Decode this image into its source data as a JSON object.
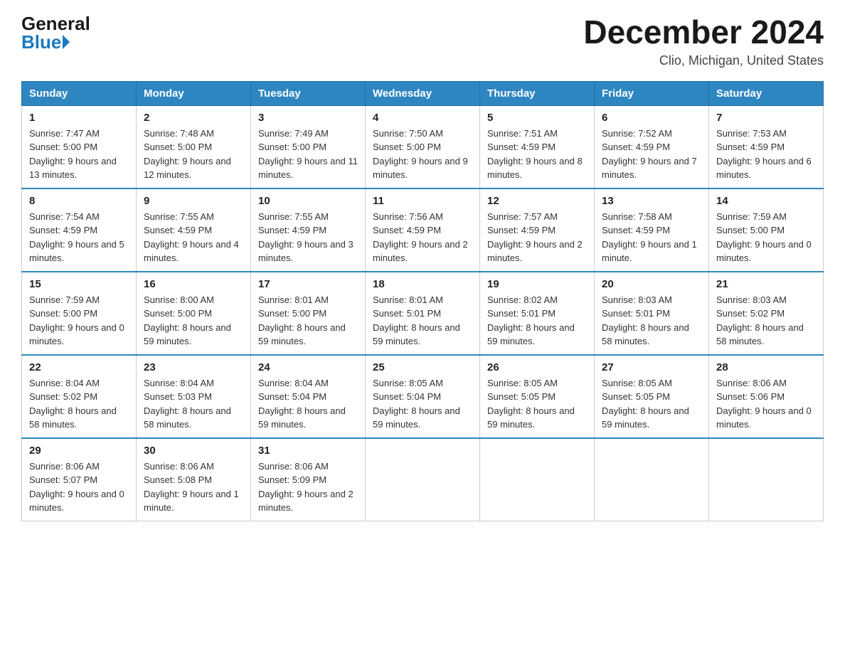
{
  "logo": {
    "general": "General",
    "blue": "Blue"
  },
  "title": "December 2024",
  "subtitle": "Clio, Michigan, United States",
  "days_header": [
    "Sunday",
    "Monday",
    "Tuesday",
    "Wednesday",
    "Thursday",
    "Friday",
    "Saturday"
  ],
  "weeks": [
    [
      {
        "day": "1",
        "sunrise": "7:47 AM",
        "sunset": "5:00 PM",
        "daylight": "9 hours and 13 minutes."
      },
      {
        "day": "2",
        "sunrise": "7:48 AM",
        "sunset": "5:00 PM",
        "daylight": "9 hours and 12 minutes."
      },
      {
        "day": "3",
        "sunrise": "7:49 AM",
        "sunset": "5:00 PM",
        "daylight": "9 hours and 11 minutes."
      },
      {
        "day": "4",
        "sunrise": "7:50 AM",
        "sunset": "5:00 PM",
        "daylight": "9 hours and 9 minutes."
      },
      {
        "day": "5",
        "sunrise": "7:51 AM",
        "sunset": "4:59 PM",
        "daylight": "9 hours and 8 minutes."
      },
      {
        "day": "6",
        "sunrise": "7:52 AM",
        "sunset": "4:59 PM",
        "daylight": "9 hours and 7 minutes."
      },
      {
        "day": "7",
        "sunrise": "7:53 AM",
        "sunset": "4:59 PM",
        "daylight": "9 hours and 6 minutes."
      }
    ],
    [
      {
        "day": "8",
        "sunrise": "7:54 AM",
        "sunset": "4:59 PM",
        "daylight": "9 hours and 5 minutes."
      },
      {
        "day": "9",
        "sunrise": "7:55 AM",
        "sunset": "4:59 PM",
        "daylight": "9 hours and 4 minutes."
      },
      {
        "day": "10",
        "sunrise": "7:55 AM",
        "sunset": "4:59 PM",
        "daylight": "9 hours and 3 minutes."
      },
      {
        "day": "11",
        "sunrise": "7:56 AM",
        "sunset": "4:59 PM",
        "daylight": "9 hours and 2 minutes."
      },
      {
        "day": "12",
        "sunrise": "7:57 AM",
        "sunset": "4:59 PM",
        "daylight": "9 hours and 2 minutes."
      },
      {
        "day": "13",
        "sunrise": "7:58 AM",
        "sunset": "4:59 PM",
        "daylight": "9 hours and 1 minute."
      },
      {
        "day": "14",
        "sunrise": "7:59 AM",
        "sunset": "5:00 PM",
        "daylight": "9 hours and 0 minutes."
      }
    ],
    [
      {
        "day": "15",
        "sunrise": "7:59 AM",
        "sunset": "5:00 PM",
        "daylight": "9 hours and 0 minutes."
      },
      {
        "day": "16",
        "sunrise": "8:00 AM",
        "sunset": "5:00 PM",
        "daylight": "8 hours and 59 minutes."
      },
      {
        "day": "17",
        "sunrise": "8:01 AM",
        "sunset": "5:00 PM",
        "daylight": "8 hours and 59 minutes."
      },
      {
        "day": "18",
        "sunrise": "8:01 AM",
        "sunset": "5:01 PM",
        "daylight": "8 hours and 59 minutes."
      },
      {
        "day": "19",
        "sunrise": "8:02 AM",
        "sunset": "5:01 PM",
        "daylight": "8 hours and 59 minutes."
      },
      {
        "day": "20",
        "sunrise": "8:03 AM",
        "sunset": "5:01 PM",
        "daylight": "8 hours and 58 minutes."
      },
      {
        "day": "21",
        "sunrise": "8:03 AM",
        "sunset": "5:02 PM",
        "daylight": "8 hours and 58 minutes."
      }
    ],
    [
      {
        "day": "22",
        "sunrise": "8:04 AM",
        "sunset": "5:02 PM",
        "daylight": "8 hours and 58 minutes."
      },
      {
        "day": "23",
        "sunrise": "8:04 AM",
        "sunset": "5:03 PM",
        "daylight": "8 hours and 58 minutes."
      },
      {
        "day": "24",
        "sunrise": "8:04 AM",
        "sunset": "5:04 PM",
        "daylight": "8 hours and 59 minutes."
      },
      {
        "day": "25",
        "sunrise": "8:05 AM",
        "sunset": "5:04 PM",
        "daylight": "8 hours and 59 minutes."
      },
      {
        "day": "26",
        "sunrise": "8:05 AM",
        "sunset": "5:05 PM",
        "daylight": "8 hours and 59 minutes."
      },
      {
        "day": "27",
        "sunrise": "8:05 AM",
        "sunset": "5:05 PM",
        "daylight": "8 hours and 59 minutes."
      },
      {
        "day": "28",
        "sunrise": "8:06 AM",
        "sunset": "5:06 PM",
        "daylight": "9 hours and 0 minutes."
      }
    ],
    [
      {
        "day": "29",
        "sunrise": "8:06 AM",
        "sunset": "5:07 PM",
        "daylight": "9 hours and 0 minutes."
      },
      {
        "day": "30",
        "sunrise": "8:06 AM",
        "sunset": "5:08 PM",
        "daylight": "9 hours and 1 minute."
      },
      {
        "day": "31",
        "sunrise": "8:06 AM",
        "sunset": "5:09 PM",
        "daylight": "9 hours and 2 minutes."
      },
      null,
      null,
      null,
      null
    ]
  ],
  "labels": {
    "sunrise_prefix": "Sunrise: ",
    "sunset_prefix": "Sunset: ",
    "daylight_prefix": "Daylight: "
  }
}
